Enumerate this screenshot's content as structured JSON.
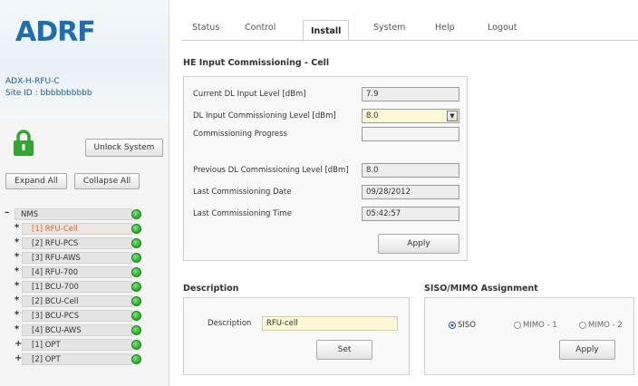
{
  "brand": {
    "logo_text": "ADRF"
  },
  "device": {
    "model": "ADX-H-RFU-C",
    "site_id": "Site ID : bbbbbbbbbb"
  },
  "left": {
    "unlock_label": "Unlock System",
    "expand_label": "Expand All",
    "collapse_label": "Collapse All",
    "tree_root": "NMS",
    "tree_items": [
      {
        "bullet": "*",
        "label": "[1] RFU-Cell"
      },
      {
        "bullet": "*",
        "label": "[2] RFU-PCS"
      },
      {
        "bullet": "*",
        "label": "[3] RFU-AWS"
      },
      {
        "bullet": "*",
        "label": "[4] RFU-700"
      },
      {
        "bullet": "*",
        "label": "[1] BCU-700"
      },
      {
        "bullet": "*",
        "label": "[2] BCU-Cell"
      },
      {
        "bullet": "*",
        "label": "[3] BCU-PCS"
      },
      {
        "bullet": "*",
        "label": "[4] BCU-AWS"
      },
      {
        "bullet": "+",
        "label": "[1] OPT"
      },
      {
        "bullet": "+",
        "label": "[2] OPT"
      }
    ]
  },
  "tabs": [
    "Status",
    "Control",
    "Install",
    "System",
    "Help",
    "Logout"
  ],
  "commissioning": {
    "title": "HE Input Commissioning - Cell",
    "current_dl_label": "Current DL Input Level [dBm]",
    "current_dl_value": "7.9",
    "dl_commission_label": "DL Input Commissioning Level [dBm]",
    "dl_commission_value": "8.0",
    "progress_label": "Commissioning Progress",
    "prev_label": "Previous DL Commissioning Level [dBm]",
    "prev_value": "8.0",
    "date_label": "Last Commissioning Date",
    "date_value": "09/28/2012",
    "time_label": "Last Commissioning Time",
    "time_value": "05:42:57",
    "apply_label": "Apply"
  },
  "description": {
    "title": "Description",
    "label": "Description",
    "value": "RFU-cell",
    "set_label": "Set"
  },
  "siso": {
    "title": "SISO/MIMO Assignment",
    "options": [
      "SISO",
      "MIMO - 1",
      "MIMO - 2"
    ],
    "selected": "SISO",
    "apply_label": "Apply"
  },
  "colors": {
    "brand_blue": "#1f6fae",
    "active_node": "#e0602a",
    "status_green": "#2ea82e",
    "lock_green": "#33a532"
  }
}
